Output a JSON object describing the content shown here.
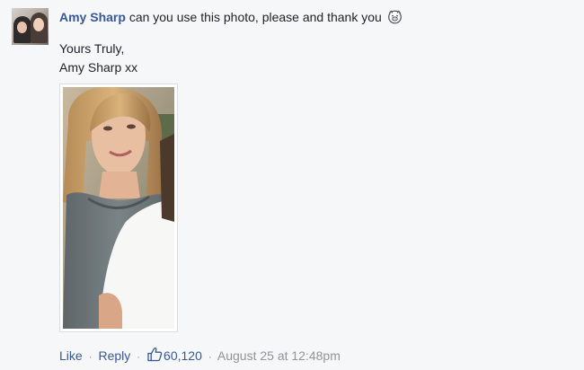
{
  "comment": {
    "author": "Amy Sharp",
    "text": "can you use this photo, please and thank you",
    "emoji_icon": "pig-face-emoji-icon",
    "body_lines": [
      "Yours Truly,",
      "Amy Sharp xx"
    ],
    "photo_icon": "photo-of-girl-icon",
    "actions": {
      "like_label": "Like",
      "reply_label": "Reply",
      "separator": "·",
      "like_count": "60,120",
      "timestamp": "August 25 at 12:48pm"
    }
  },
  "colors": {
    "link": "#365899",
    "meta": "#90949c",
    "text": "#1d2129",
    "background": "#f6f7f9"
  }
}
